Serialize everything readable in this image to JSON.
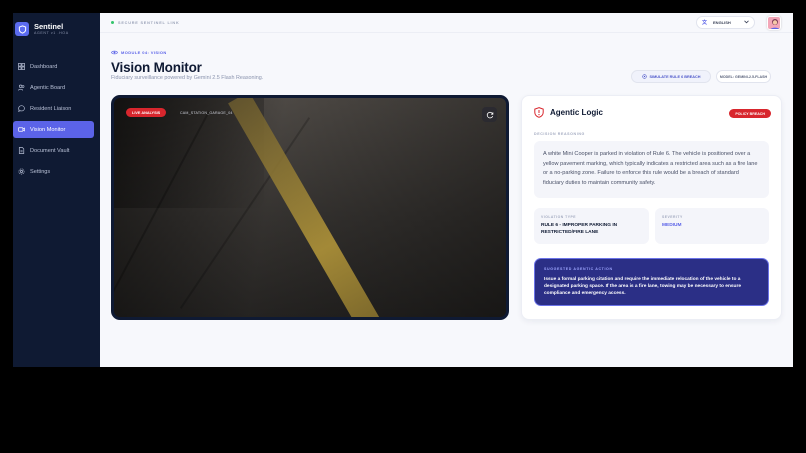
{
  "brand": {
    "title": "Sentinel",
    "subtitle": "AGENT v1 .HOA"
  },
  "sidebar": {
    "items": [
      {
        "label": "Dashboard",
        "icon": "grid-icon",
        "active": false
      },
      {
        "label": "Agentic Board",
        "icon": "users-icon",
        "active": false
      },
      {
        "label": "Resident Liaison",
        "icon": "chat-icon",
        "active": false
      },
      {
        "label": "Vision Monitor",
        "icon": "camera-icon",
        "active": true
      },
      {
        "label": "Document Vault",
        "icon": "document-icon",
        "active": false
      },
      {
        "label": "Settings",
        "icon": "gear-icon",
        "active": false
      }
    ]
  },
  "topbar": {
    "status": "SECURE SENTINEL LINK",
    "language": "ENGLISH"
  },
  "header": {
    "module": "MODULE 04: VISION",
    "title": "Vision Monitor",
    "subtitle": "Fiduciary surveillance powered by Gemini 2.5 Flash Reasoning.",
    "simulate_label": "SIMULATE RULE 6 BREACH",
    "model_label": "MODEL: GEMINI-2.5-FLASH"
  },
  "video": {
    "live_label": "LIVE ANALYSIS",
    "camera_id": "CAM_STATION_GARAGE_04"
  },
  "panel": {
    "title": "Agentic Logic",
    "badge": "POLICY BREACH",
    "reasoning_label": "DECISION REASONING",
    "reasoning": "A white Mini Cooper is parked in violation of Rule 6. The vehicle is positioned over a yellow pavement marking, which typically indicates a restricted area such as a fire lane or a no-parking zone. Failure to enforce this rule would be a breach of standard fiduciary duties to maintain community safety.",
    "violation_label": "VIOLATION TYPE",
    "violation_value": "RULE 6 - IMPROPER PARKING IN RESTRICTED/FIRE LANE",
    "severity_label": "SEVERITY",
    "severity_value": "MEDIUM",
    "action_label": "SUGGESTED AGENTIC ACTION",
    "action_value": "Issue a formal parking citation and require the immediate relocation of the vehicle to a designated parking space. If the area is a fire lane, towing may be necessary to ensure compliance and emergency access."
  },
  "colors": {
    "accent": "#5b63e8",
    "danger": "#d8262d",
    "sidebar": "#0f1a33",
    "action_bg": "#2b2f86"
  }
}
